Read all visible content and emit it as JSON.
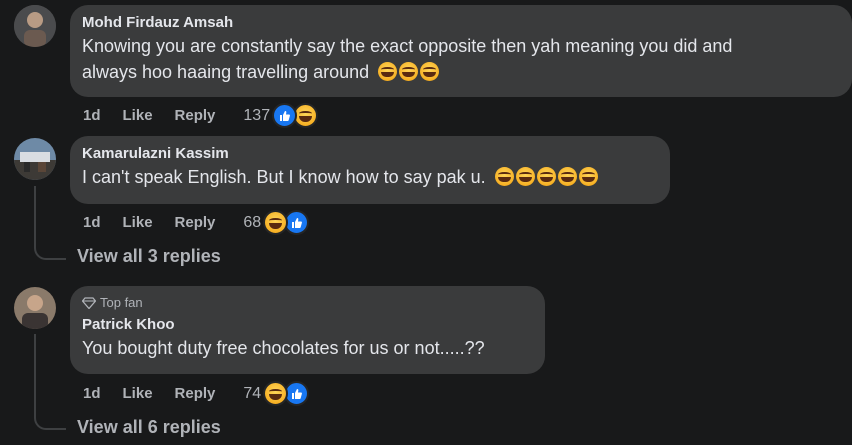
{
  "comments": [
    {
      "author": "Mohd Firdauz Amsah",
      "text_line1": "Knowing you are constantly say the exact opposite then yah meaning you did and",
      "text_line2": "always hoo haaing travelling around",
      "trailing_emojis": [
        "laugh-cry",
        "laugh-cry",
        "laugh-cry"
      ],
      "time": "1d",
      "like_label": "Like",
      "reply_label": "Reply",
      "reaction_count": "137",
      "reaction_icons": [
        "like",
        "haha"
      ]
    },
    {
      "author": "Kamarulazni Kassim",
      "text": "I can't speak English. But I know how to say pak u.",
      "trailing_emojis": [
        "laugh-cry",
        "laugh-cry",
        "laugh-cry",
        "laugh-cry",
        "laugh-cry"
      ],
      "time": "1d",
      "like_label": "Like",
      "reply_label": "Reply",
      "reaction_count": "68",
      "reaction_icons": [
        "haha",
        "like"
      ],
      "view_replies": "View all 3 replies"
    },
    {
      "badge": "Top fan",
      "author": "Patrick Khoo",
      "text": "You bought duty free chocolates for us or not.....??",
      "time": "1d",
      "like_label": "Like",
      "reply_label": "Reply",
      "reaction_count": "74",
      "reaction_icons": [
        "haha",
        "like"
      ],
      "view_replies": "View all 6 replies"
    }
  ]
}
